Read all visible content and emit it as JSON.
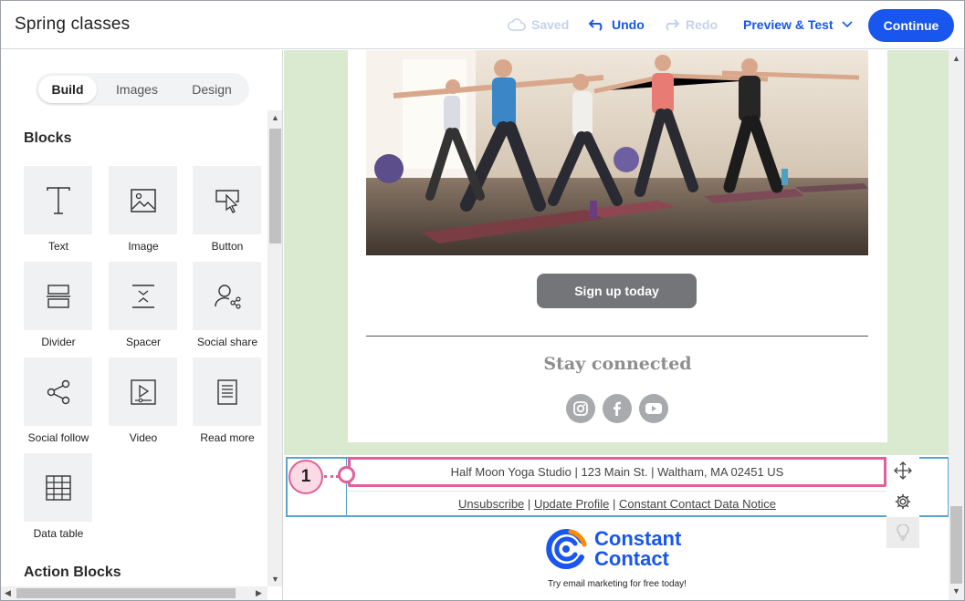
{
  "header": {
    "title": "Spring classes",
    "saved": "Saved",
    "undo": "Undo",
    "redo": "Redo",
    "preview": "Preview & Test",
    "continue": "Continue"
  },
  "sidebar": {
    "tabs": [
      {
        "label": "Build",
        "active": true
      },
      {
        "label": "Images",
        "active": false
      },
      {
        "label": "Design",
        "active": false
      }
    ],
    "blocks_heading": "Blocks",
    "blocks": [
      {
        "label": "Text",
        "icon": "text-icon"
      },
      {
        "label": "Image",
        "icon": "image-icon"
      },
      {
        "label": "Button",
        "icon": "button-icon"
      },
      {
        "label": "Divider",
        "icon": "divider-icon"
      },
      {
        "label": "Spacer",
        "icon": "spacer-icon"
      },
      {
        "label": "Social share",
        "icon": "social-share-icon"
      },
      {
        "label": "Social follow",
        "icon": "social-follow-icon"
      },
      {
        "label": "Video",
        "icon": "video-icon"
      },
      {
        "label": "Read more",
        "icon": "read-more-icon"
      },
      {
        "label": "Data table",
        "icon": "data-table-icon"
      }
    ],
    "action_heading": "Action Blocks"
  },
  "email": {
    "signup_button": "Sign up today",
    "stay_connected": "Stay connected",
    "social": [
      "instagram-icon",
      "facebook-icon",
      "youtube-icon"
    ],
    "footer_address": "Half Moon Yoga Studio | 123 Main St. | Waltham, MA 02451 US",
    "footer_links": {
      "unsubscribe": "Unsubscribe",
      "sep1": "|",
      "update_profile": "Update Profile",
      "sep2": "|",
      "data_notice": "Constant Contact Data Notice"
    },
    "callout_number": "1",
    "brand_line1": "Constant",
    "brand_line2": "Contact",
    "brand_tagline": "Try email marketing for free today!"
  },
  "colors": {
    "accent": "#1856ed",
    "highlight": "#e0609b",
    "selection": "#5ba3d0",
    "email_background": "#daead0"
  }
}
